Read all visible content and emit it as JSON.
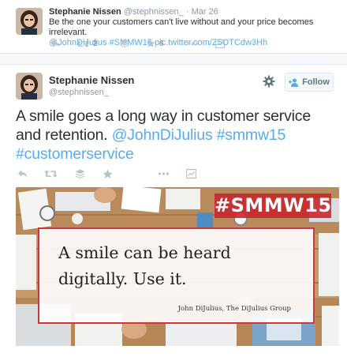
{
  "context_tweet": {
    "author_name": "Stephanie Nissen",
    "author_handle": "@stephnissen_",
    "separator": "·",
    "time": "Mar 26",
    "text": "Be the one your customers can't live without and your price becomes irrelevant.",
    "links": "@JohnDiJulius #SMMW15 pic.twitter.com/Z5OTCdw3Hh",
    "retweet_count": "2",
    "favorite_count": "6"
  },
  "main_tweet": {
    "author_name": "Stephanie Nissen",
    "author_handle": "@stephnissen_",
    "follow_label": "Follow",
    "text_plain": "A smile goes a long way in customer service and retention.",
    "mention": "@JohnDiJulius",
    "hashtag_1": "#smmw15",
    "hashtag_2": "#customerservice"
  },
  "media": {
    "hashtag_overlay": "#SMMW15",
    "quote_line_1": "A smile can be heard",
    "quote_line_2": "digitally. Use it.",
    "quote_attribution": "John DiJulius, The DiJulius Group"
  },
  "icons": {
    "reply": "reply-icon",
    "retweet": "retweet-icon",
    "buffer": "buffer-icon",
    "favorite": "star-icon",
    "more": "more-dots-icon",
    "analytics": "analytics-icon",
    "settings": "gear-icon",
    "follow": "add-person-icon"
  },
  "colors": {
    "link": "#55acee",
    "text": "#292f33",
    "muted": "#8899a6",
    "action_icon": "#b8c3cc",
    "image_accent": "#c8282e"
  }
}
